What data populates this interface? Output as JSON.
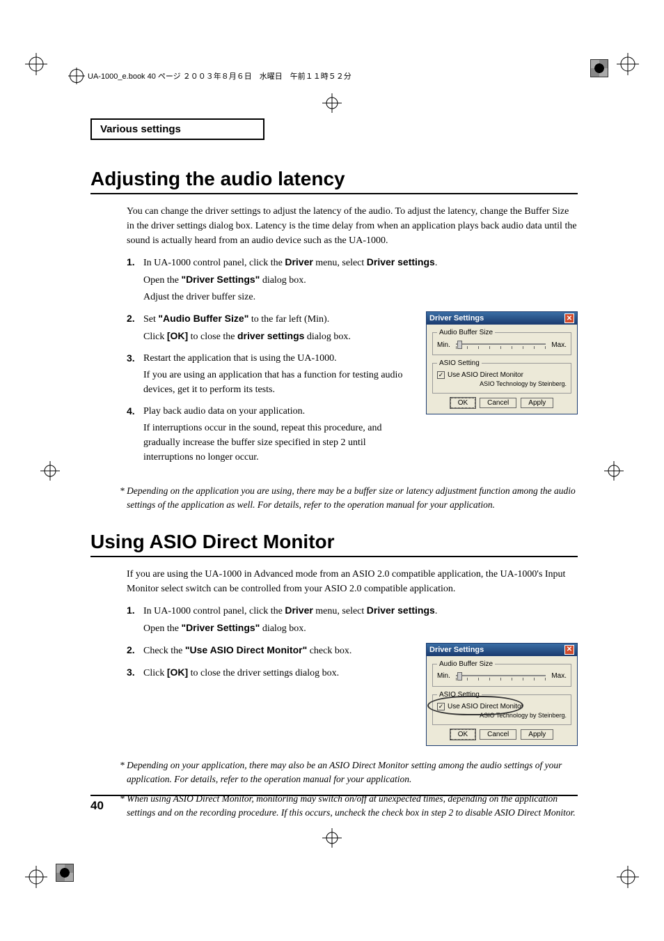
{
  "header_text": "UA-1000_e.book  40 ページ  ２００３年８月６日　水曜日　午前１１時５２分",
  "section_tab": "Various settings",
  "page_number": "40",
  "section1": {
    "title": "Adjusting the audio latency",
    "intro": "You can change the driver settings to adjust the latency of the audio. To adjust the latency, change the Buffer Size in the driver settings dialog box. Latency is the time delay from when an application plays back audio data until the sound is actually heard from an audio device such as the UA-1000.",
    "steps": [
      {
        "pre": "In UA-1000 control panel, click the ",
        "b1": "Driver",
        "mid1": " menu, select ",
        "b2": "Driver settings",
        "tail": ".",
        "sub1_pre": "Open the ",
        "sub1_b": "\"Driver Settings\"",
        "sub1_tail": " dialog box.",
        "sub2": "Adjust the driver buffer size."
      },
      {
        "pre": "Set ",
        "b1": "\"Audio Buffer Size\"",
        "tail": " to the far left (Min).",
        "sub1_pre": "Click ",
        "sub1_b": "[OK]",
        "sub1_mid": " to close the ",
        "sub1_b2": "driver settings",
        "sub1_tail": " dialog box."
      },
      {
        "main": "Restart the application that is using the UA-1000.",
        "sub": "If you are using an application that has a function for testing audio devices, get it to perform its tests."
      },
      {
        "main": "Play back audio data on your application.",
        "sub": "If interruptions occur in the sound, repeat this procedure, and gradually increase the buffer size specified in step 2 until interruptions no longer occur."
      }
    ],
    "footnote": "*  Depending on the application you are using, there may be a buffer size or latency adjustment function among the audio settings of the application as well. For details, refer to the operation manual for your application."
  },
  "section2": {
    "title": "Using ASIO Direct Monitor",
    "intro": "If you are using the UA-1000 in Advanced mode from an ASIO 2.0 compatible application, the UA-1000's Input Monitor select switch can be controlled from your ASIO 2.0 compatible application.",
    "steps": [
      {
        "pre": "In UA-1000 control panel, click the ",
        "b1": "Driver",
        "mid1": " menu, select ",
        "b2": "Driver settings",
        "tail": ".",
        "sub1_pre": "Open the ",
        "sub1_b": "\"Driver Settings\"",
        "sub1_tail": " dialog box."
      },
      {
        "pre": "Check the ",
        "b1": "\"Use ASIO Direct Monitor\"",
        "tail": " check box."
      },
      {
        "pre": "Click ",
        "b1": "[OK]",
        "tail": " to close the driver settings dialog box."
      }
    ],
    "footnote1": "*  Depending on your application, there may also be an ASIO Direct Monitor setting among the audio settings of your application. For details, refer to the operation manual for your application.",
    "footnote2": "*  When using ASIO Direct Monitor, monitoring may switch on/off at unexpected times, depending on the application settings and on the recording procedure. If this occurs, uncheck the check box in step 2 to disable ASIO Direct Monitor."
  },
  "dialog": {
    "title": "Driver Settings",
    "buffer_legend": "Audio Buffer Size",
    "min": "Min.",
    "max": "Max.",
    "asio_legend": "ASIO Setting",
    "checkbox_label": "Use ASIO Direct Monitor",
    "credit": "ASIO Technology by Steinberg.",
    "ok": "OK",
    "cancel": "Cancel",
    "apply": "Apply",
    "close_glyph": "✕"
  }
}
